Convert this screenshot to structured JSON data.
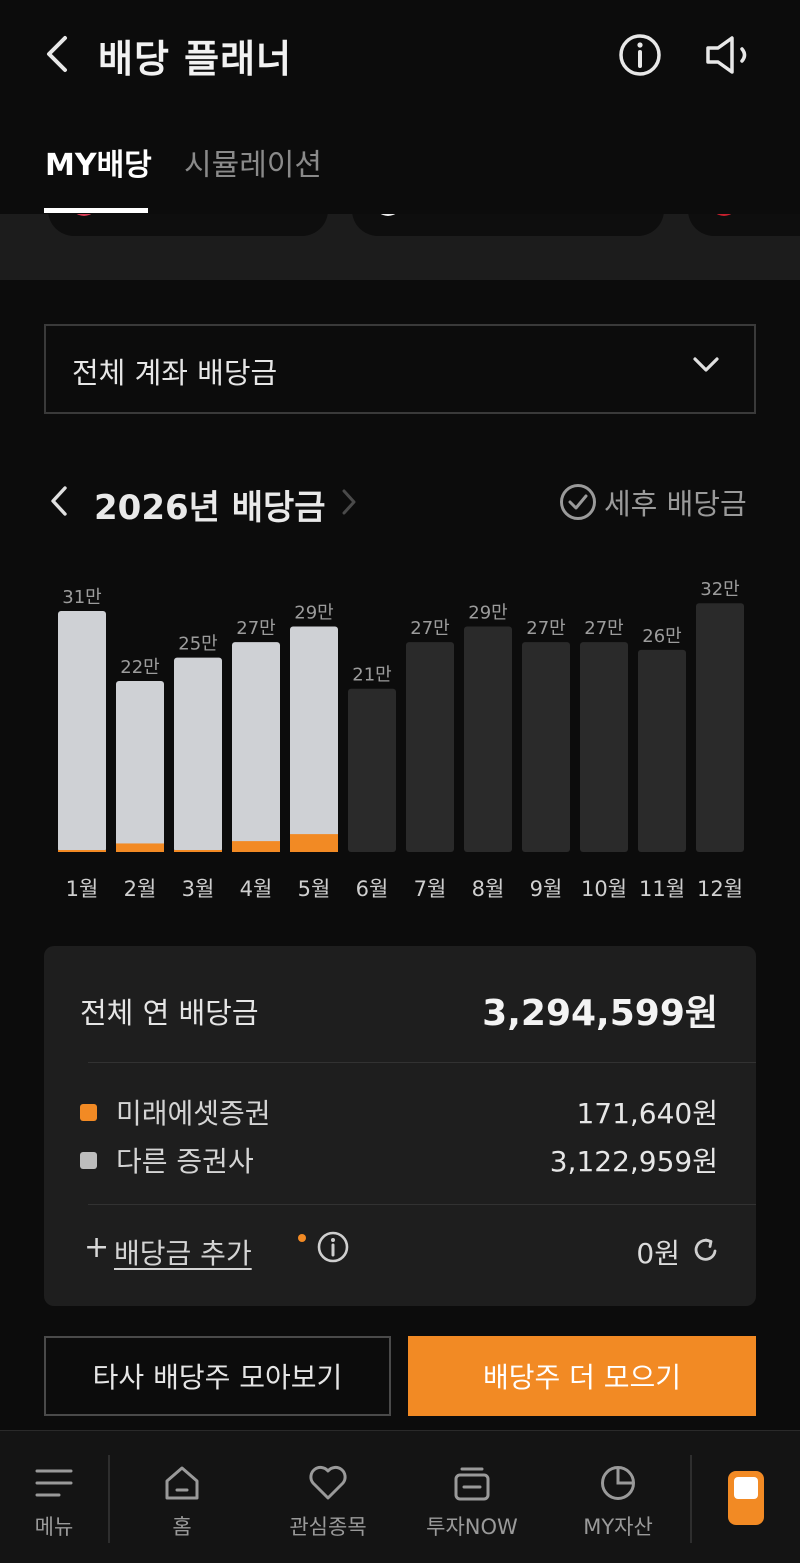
{
  "header": {
    "title": "배당 플래너"
  },
  "tabs": [
    {
      "label": "MY배당",
      "active": true
    },
    {
      "label": "시뮬레이션",
      "active": false
    }
  ],
  "account_select": {
    "selected": "전체 계좌 배당금"
  },
  "year_nav": {
    "title": "2026년 배당금",
    "after_tax_label": "세후 배당금"
  },
  "chart_data": {
    "type": "bar",
    "categories": [
      "1월",
      "2월",
      "3월",
      "4월",
      "5월",
      "6월",
      "7월",
      "8월",
      "9월",
      "10월",
      "11월",
      "12월"
    ],
    "labels": [
      "31만",
      "22만",
      "25만",
      "27만",
      "29만",
      "21만",
      "27만",
      "29만",
      "27만",
      "27만",
      "26만",
      "32만"
    ],
    "series": [
      {
        "name": "미래에셋증권",
        "values": [
          0.2,
          1.1,
          0.2,
          1.4,
          2.3,
          0,
          0,
          0,
          0,
          0,
          0,
          0
        ]
      },
      {
        "name": "다른 증권사",
        "values": [
          30.8,
          20.9,
          24.8,
          25.6,
          26.7,
          21,
          27,
          29,
          27,
          27,
          26,
          32
        ]
      }
    ],
    "past_months": 5,
    "ylabel": "",
    "colors": {
      "mirae": "#f28a24",
      "other_past": "#cfd1d5",
      "future": "#2a2a2a"
    }
  },
  "summary": {
    "total_label": "전체 연 배당금",
    "total_value": "3,294,599원",
    "legend": [
      {
        "name": "미래에셋증권",
        "value": "171,640원",
        "color": "#f28a24"
      },
      {
        "name": "다른 증권사",
        "value": "3,122,959원",
        "color": "#bdbdbd"
      }
    ],
    "add_plus": "+",
    "add_label": "배당금 추가",
    "add_value": "0원"
  },
  "buttons": {
    "other_stocks": "타사 배당주 모아보기",
    "collect_more": "배당주 더 모으기"
  },
  "bottom_nav": [
    {
      "label": "메뉴",
      "icon": "menu-icon"
    },
    {
      "label": "홈",
      "icon": "home-icon"
    },
    {
      "label": "관심종목",
      "icon": "heart-icon"
    },
    {
      "label": "투자NOW",
      "icon": "tv-icon"
    },
    {
      "label": "MY자산",
      "icon": "pie-chart-icon"
    }
  ]
}
